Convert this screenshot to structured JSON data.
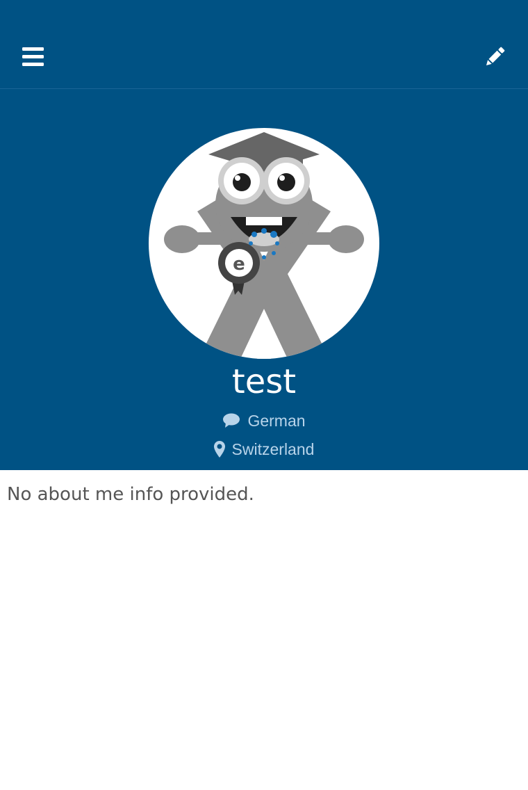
{
  "header": {
    "menu_icon": "bars-icon",
    "edit_icon": "pencil-icon",
    "background_color": "#005284"
  },
  "profile": {
    "avatar_icon": "mascot-avatar",
    "username": "test",
    "language_icon": "speech-bubble-icon",
    "language": "German",
    "location_icon": "map-pin-icon",
    "location": "Switzerland"
  },
  "about": {
    "text": "No about me info provided."
  }
}
